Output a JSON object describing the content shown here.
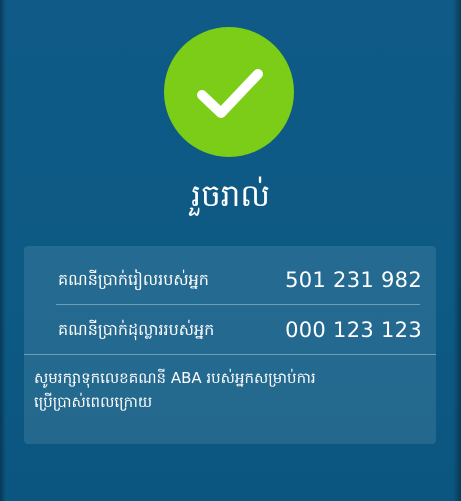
{
  "status": {
    "title": "រួចរាល់",
    "icon": "check-icon",
    "color": "#7ccd17"
  },
  "accounts": {
    "riel_label": "គណនីប្រាក់រៀលរបស់អ្នក",
    "riel_number": "501 231 982",
    "dollar_label": "គណនីប្រាក់ដុល្លាររបស់អ្នក",
    "dollar_number": "000 123 123"
  },
  "note": {
    "line1": "សូមរក្សាទុកលេខគណនី ABA របស់អ្នកសម្រាប់ការ",
    "line2": "ប្រើប្រាស់ពេលក្រោយ"
  }
}
